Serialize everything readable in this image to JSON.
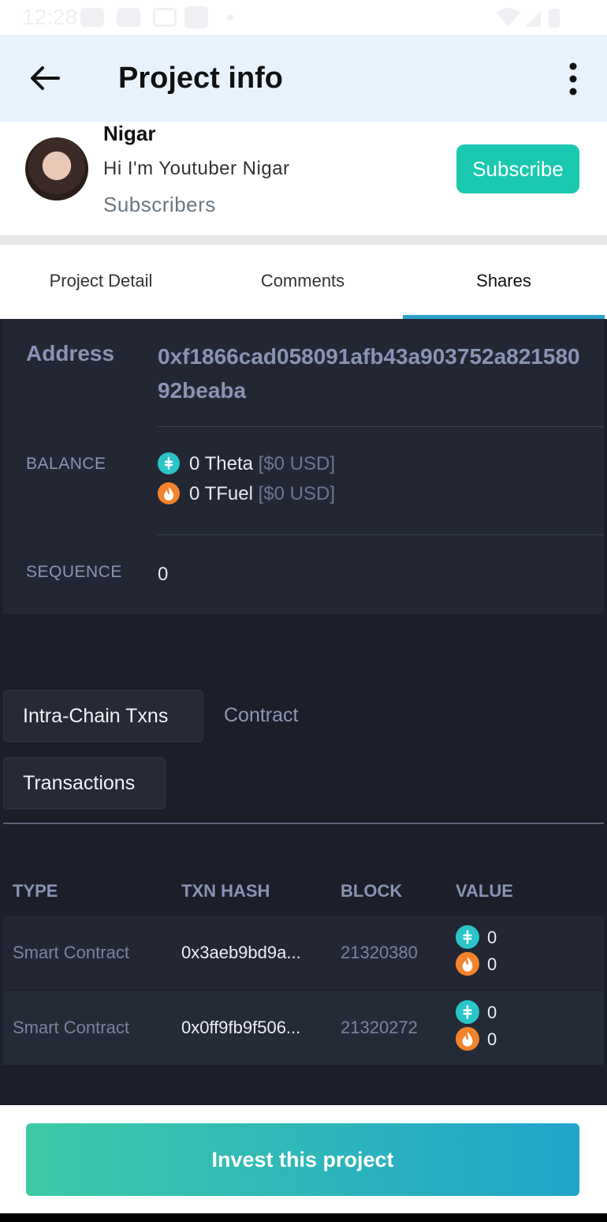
{
  "status_bar": {
    "time": "12:28"
  },
  "app_bar": {
    "title": "Project info"
  },
  "creator": {
    "name": "Nigar",
    "bio": "Hi I'm Youtuber Nigar",
    "subscribers_label": "Subscribers",
    "subscribe_label": "Subscribe"
  },
  "tabs": [
    {
      "label": "Project Detail",
      "active": false
    },
    {
      "label": "Comments",
      "active": false
    },
    {
      "label": "Shares",
      "active": true
    }
  ],
  "account": {
    "address_label": "Address",
    "address": "0xf1866cad058091afb43a903752a82158092beaba",
    "balance_label": "BALANCE",
    "theta_amount": "0 Theta",
    "theta_usd": "[$0 USD]",
    "tfuel_amount": "0 TFuel",
    "tfuel_usd": "[$0 USD]",
    "sequence_label": "SEQUENCE",
    "sequence": "0"
  },
  "tx_tabs": [
    {
      "label": "Intra-Chain Txns",
      "active": true
    },
    {
      "label": "Contract",
      "active": false
    },
    {
      "label": "Transactions",
      "active": true
    }
  ],
  "table": {
    "headers": [
      "TYPE",
      "TXN HASH",
      "BLOCK",
      "VALUE"
    ],
    "rows": [
      {
        "type": "Smart Contract",
        "hash": "0x3aeb9bd9a...",
        "block": "21320380",
        "theta": "0",
        "tfuel": "0"
      },
      {
        "type": "Smart Contract",
        "hash": "0x0ff9fb9f506...",
        "block": "21320272",
        "theta": "0",
        "tfuel": "0"
      }
    ]
  },
  "cta": {
    "label": "Invest this project"
  },
  "colors": {
    "accent": "#1ac8b0",
    "tab_indicator": "#2da1c9",
    "theta": "#2ac4c9",
    "tfuel": "#f3842b"
  }
}
